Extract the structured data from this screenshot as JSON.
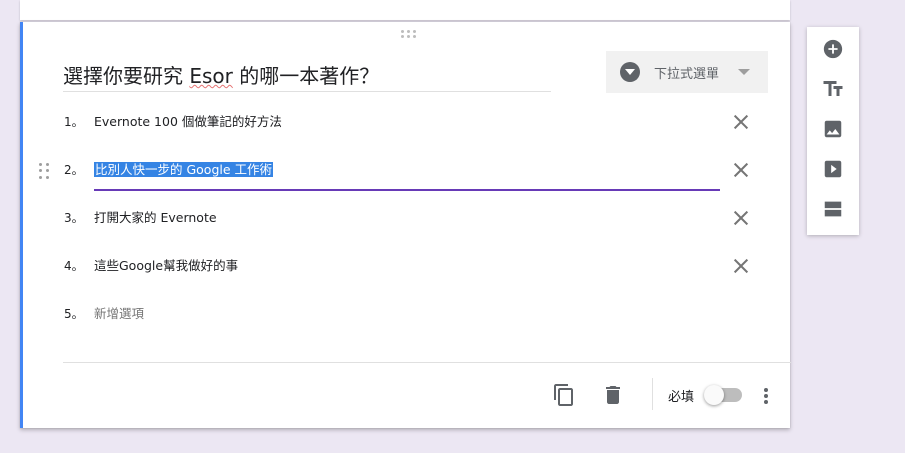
{
  "question": {
    "title_before": "選擇你要研究 ",
    "title_misspelled": "Esor",
    "title_after": " 的哪一本著作？",
    "type_label": "下拉式選單"
  },
  "options": [
    {
      "number": "1。",
      "text": "Evernote 100 個做筆記的好方法"
    },
    {
      "number": "2。",
      "text": "比別人快一步的 Google 工作術"
    },
    {
      "number": "3。",
      "text": "打開大家的 Evernote"
    },
    {
      "number": "4。",
      "text": "這些Google幫我做好的事"
    },
    {
      "number": "5。",
      "text": "新增選項"
    }
  ],
  "footer": {
    "required_label": "必填",
    "required_on": false
  },
  "icons": {
    "copy": "copy-icon",
    "delete": "trash-icon",
    "more": "more-vert-icon",
    "add_question": "add-circle-icon",
    "add_title": "title-text-icon",
    "add_image": "image-icon",
    "add_video": "video-icon",
    "add_section": "section-icon",
    "type": "dropdown-circle-icon",
    "remove": "close-icon",
    "drag": "drag-handle-icon"
  },
  "colors": {
    "accent_left": "#4285f4",
    "focus_underline": "#673ab7",
    "selection": "#3584e4",
    "background": "#ece7f3"
  }
}
